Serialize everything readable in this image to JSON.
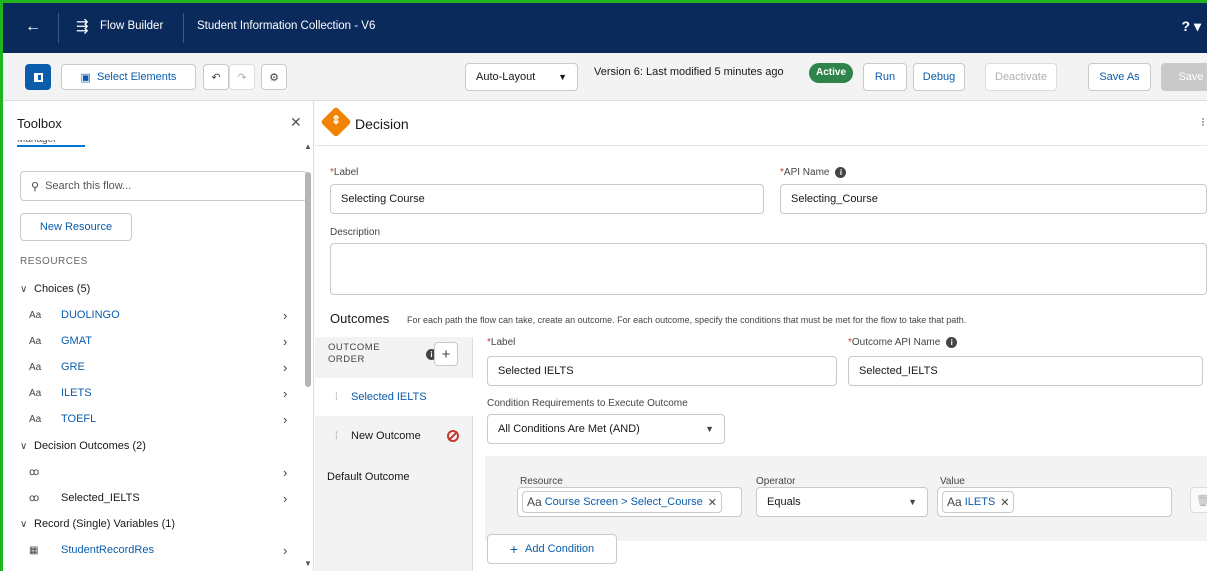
{
  "header": {
    "back_icon": "arrow-left-icon",
    "app_icon": "flow-icon",
    "app_name": "Flow Builder",
    "flow_name": "Student Information Collection - V6",
    "help": "? ▾"
  },
  "toolbar": {
    "select_elements": "Select Elements",
    "layout_mode": "Auto-Layout",
    "version_text": "Version 6: Last modified 5 minutes ago",
    "status_badge": "Active",
    "run": "Run",
    "debug": "Debug",
    "deactivate": "Deactivate",
    "save_as": "Save As",
    "save": "Save"
  },
  "toolbox": {
    "title": "Toolbox",
    "tab_partial": "Manager",
    "search_placeholder": "Search this flow...",
    "new_resource": "New Resource",
    "resources_label": "RESOURCES",
    "groups": [
      {
        "label": "Choices (5)"
      },
      {
        "label": "Decision Outcomes (2)"
      },
      {
        "label": "Record (Single) Variables (1)"
      }
    ],
    "choices": [
      {
        "icon": "Aa",
        "name": "DUOLINGO"
      },
      {
        "icon": "Aa",
        "name": "GMAT"
      },
      {
        "icon": "Aa",
        "name": "GRE"
      },
      {
        "icon": "Aa",
        "name": "ILETS"
      },
      {
        "icon": "Aa",
        "name": "TOEFL"
      }
    ],
    "decision_outcomes": [
      {
        "icon": "ꝏ",
        "name": ""
      },
      {
        "icon": "ꝏ",
        "name": "Selected_IELTS"
      }
    ],
    "record_variables": [
      {
        "icon": "▦",
        "name": "StudentRecordRes"
      }
    ]
  },
  "editor": {
    "element_type": "Decision",
    "label_label": "Label",
    "label_value": "Selecting Course",
    "api_name_label": "API Name",
    "api_name_value": "Selecting_Course",
    "description_label": "Description",
    "description_value": "",
    "outcomes_title": "Outcomes",
    "outcomes_desc": "For each path the flow can take, create an outcome. For each outcome, specify the conditions that must be met for the flow to take that path.",
    "outcome_order_label": "OUTCOME ORDER",
    "outcome_list": [
      {
        "label": "Selected IELTS"
      },
      {
        "label": "New Outcome"
      },
      {
        "label": "Default Outcome"
      }
    ],
    "outcome": {
      "label_label": "Label",
      "label_value": "Selected IELTS",
      "api_label": "Outcome API Name",
      "api_value": "Selected_IELTS",
      "cond_req_label": "Condition Requirements to Execute Outcome",
      "cond_req_value": "All Conditions Are Met (AND)",
      "resource_label": "Resource",
      "resource_value": "Course Screen > Select_Course",
      "operator_label": "Operator",
      "operator_value": "Equals",
      "value_label": "Value",
      "value_value": "ILETS",
      "add_condition": "Add Condition"
    }
  }
}
